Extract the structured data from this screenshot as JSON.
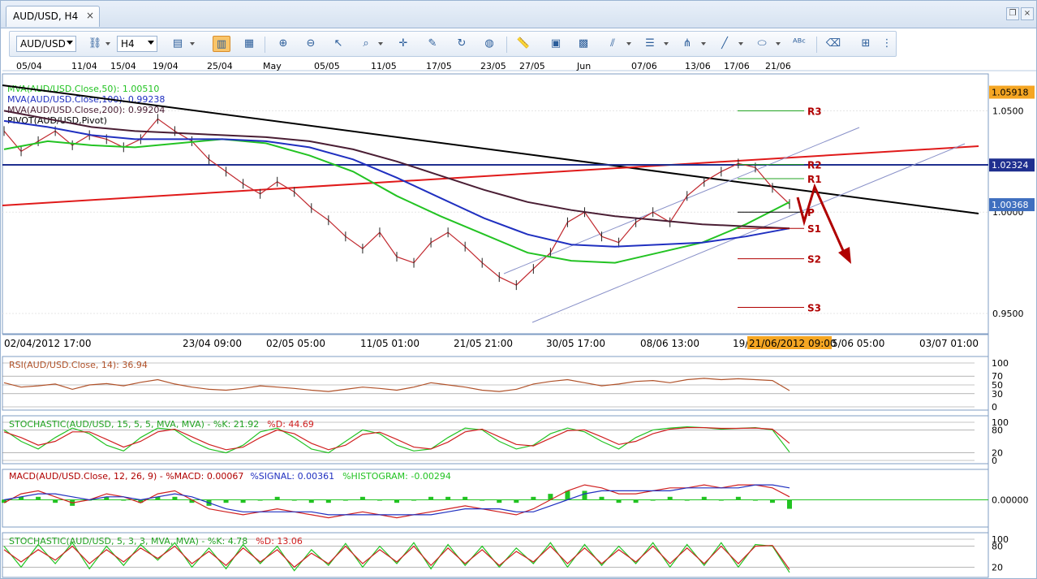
{
  "window": {
    "tab_title": "AUD/USD, H4",
    "close_glyph": "×"
  },
  "toolbar": {
    "symbol": "AUD/USD",
    "timeframe": "H4",
    "tools": [
      "chain-link-icon",
      "chart-type-icon",
      "bar-chart-icon",
      "data-window-icon",
      "zoom-in-icon",
      "zoom-out-icon",
      "cursor-icon",
      "zoom-area-icon",
      "crosshair-icon",
      "annotate-icon",
      "rotate-icon",
      "globe-icon",
      "ruler-icon",
      "picture-icon",
      "template-icon",
      "fibonacci-icon",
      "horizontal-lines-icon",
      "pitchfork-icon",
      "trendline-icon",
      "ellipse-icon",
      "text-icon",
      "eraser-icon",
      "object-tree-icon",
      "more-icon"
    ]
  },
  "chart_data": [
    {
      "type": "line",
      "panel": "price",
      "top_dates": [
        "05/04",
        "11/04",
        "15/04",
        "19/04",
        "25/04",
        "May",
        "05/05",
        "11/05",
        "17/05",
        "23/05",
        "27/05",
        "Jun",
        "07/06",
        "13/06",
        "17/06",
        "21/06"
      ],
      "bottom_dates": [
        "02/04/2012 17:00",
        "23/04 09:00",
        "02/05 05:00",
        "11/05 01:00",
        "21/05 21:00",
        "30/05 17:00",
        "08/06 13:00",
        "19/",
        "21/06/2012 09:00",
        "5/06 05:00",
        "03/07 01:00"
      ],
      "ylim": [
        0.94,
        1.065
      ],
      "yticks": [
        "1.0500",
        "1.0000",
        "0.9500"
      ],
      "price_tags": [
        {
          "label": "1.05918",
          "value": 1.05918,
          "color": "#f5a623"
        },
        {
          "label": "1.02324",
          "value": 1.02324,
          "color": "#1f2f8f"
        },
        {
          "label": "1.00368",
          "value": 1.00368,
          "color": "#3f6fbf"
        }
      ],
      "legend": [
        {
          "text": "MVA(AUD/USD.Close,50): 1.00510",
          "color": "#23c323"
        },
        {
          "text": "MVA(AUD/USD.Close,100): 0.99238",
          "color": "#2030c0"
        },
        {
          "text": "MVA(AUD/USD.Close,200): 0.99204",
          "color": "#4a1e34"
        },
        {
          "text": "PIVOT(AUD/USD,Pivot)",
          "color": "#000000"
        }
      ],
      "pivot_levels": [
        {
          "label": "R3",
          "value": 1.05
        },
        {
          "label": "R2",
          "value": 1.0235
        },
        {
          "label": "R1",
          "value": 1.0165
        },
        {
          "label": "P",
          "value": 1.0
        },
        {
          "label": "S1",
          "value": 0.992
        },
        {
          "label": "S2",
          "value": 0.977
        },
        {
          "label": "S3",
          "value": 0.953
        }
      ],
      "series": [
        {
          "name": "MVA(AUD/USD.Close,50)",
          "color": "#23c323",
          "values": [
            1.031,
            1.035,
            1.033,
            1.032,
            1.034,
            1.036,
            1.034,
            1.028,
            1.02,
            1.008,
            0.998,
            0.989,
            0.98,
            0.976,
            0.975,
            0.98,
            0.985,
            0.994,
            1.005
          ]
        },
        {
          "name": "MVA(AUD/USD.Close,100)",
          "color": "#2030c0",
          "values": [
            1.045,
            1.042,
            1.038,
            1.036,
            1.036,
            1.036,
            1.035,
            1.032,
            1.026,
            1.017,
            1.007,
            0.997,
            0.989,
            0.984,
            0.983,
            0.984,
            0.985,
            0.988,
            0.992
          ]
        },
        {
          "name": "MVA(AUD/USD.Close,200)",
          "color": "#4a1e34",
          "values": [
            1.05,
            1.046,
            1.042,
            1.04,
            1.039,
            1.038,
            1.037,
            1.035,
            1.031,
            1.025,
            1.018,
            1.011,
            1.005,
            1.001,
            0.998,
            0.996,
            0.994,
            0.993,
            0.992
          ]
        }
      ],
      "close": [
        1.04,
        1.03,
        1.035,
        1.04,
        1.033,
        1.038,
        1.036,
        1.032,
        1.036,
        1.046,
        1.04,
        1.035,
        1.026,
        1.02,
        1.014,
        1.009,
        1.015,
        1.01,
        1.002,
        0.996,
        0.988,
        0.982,
        0.99,
        0.978,
        0.975,
        0.985,
        0.99,
        0.983,
        0.975,
        0.968,
        0.964,
        0.972,
        0.98,
        0.995,
        1.0,
        0.988,
        0.985,
        0.995,
        1.0,
        0.995,
        1.008,
        1.015,
        1.02,
        1.024,
        1.022,
        1.012,
        1.004
      ]
    },
    {
      "type": "line",
      "panel": "rsi",
      "label": "RSI(AUD/USD.Close, 14): 36.94",
      "ylim": [
        0,
        100
      ],
      "yticks": [
        "100",
        "70",
        "50",
        "30",
        "0"
      ],
      "values": [
        55,
        45,
        48,
        52,
        40,
        50,
        53,
        48,
        56,
        62,
        52,
        45,
        40,
        38,
        42,
        48,
        45,
        42,
        38,
        35,
        40,
        45,
        42,
        38,
        45,
        55,
        50,
        45,
        38,
        35,
        40,
        52,
        58,
        62,
        55,
        48,
        52,
        58,
        60,
        55,
        62,
        65,
        62,
        64,
        62,
        60,
        37
      ]
    },
    {
      "type": "line",
      "panel": "stochastic",
      "label": "STOCHASTIC(AUD/USD, 15, 5, 5, MVA, MVA) - %K: 21.92",
      "d_label": "%D: 44.69",
      "ylim": [
        0,
        100
      ],
      "yticks": [
        "100",
        "80",
        "20",
        "0"
      ],
      "k_values": [
        80,
        50,
        30,
        60,
        85,
        70,
        40,
        25,
        60,
        85,
        80,
        50,
        30,
        20,
        40,
        75,
        85,
        60,
        30,
        20,
        50,
        80,
        70,
        40,
        25,
        30,
        60,
        85,
        80,
        50,
        30,
        40,
        70,
        85,
        75,
        50,
        30,
        60,
        80,
        85,
        88,
        86,
        82,
        84,
        86,
        80,
        22
      ],
      "d_values": [
        75,
        60,
        40,
        50,
        75,
        75,
        55,
        35,
        50,
        75,
        82,
        62,
        42,
        28,
        35,
        60,
        80,
        70,
        45,
        28,
        40,
        68,
        74,
        55,
        35,
        30,
        48,
        75,
        82,
        62,
        42,
        38,
        58,
        78,
        80,
        62,
        42,
        50,
        70,
        82,
        86,
        86,
        84,
        84,
        85,
        82,
        45
      ]
    },
    {
      "type": "line",
      "panel": "macd",
      "label": "MACD(AUD/USD.Close, 12, 26, 9) - %MACD: 0.00067",
      "signal_label": "%SIGNAL: 0.00361",
      "histogram_label": "%HISTOGRAM: -0.00294",
      "ylim": [
        -0.008,
        0.008
      ],
      "yticks": [
        "0.00000"
      ],
      "macd": [
        -0.001,
        0.002,
        0.003,
        0.001,
        -0.001,
        0.0,
        0.002,
        0.001,
        -0.001,
        0.002,
        0.003,
        0.0,
        -0.003,
        -0.004,
        -0.005,
        -0.004,
        -0.003,
        -0.004,
        -0.005,
        -0.006,
        -0.005,
        -0.004,
        -0.005,
        -0.006,
        -0.005,
        -0.004,
        -0.003,
        -0.002,
        -0.003,
        -0.004,
        -0.005,
        -0.003,
        0.0,
        0.003,
        0.005,
        0.004,
        0.002,
        0.002,
        0.003,
        0.004,
        0.004,
        0.005,
        0.004,
        0.005,
        0.005,
        0.004,
        0.001
      ],
      "signal": [
        0.0,
        0.001,
        0.002,
        0.002,
        0.001,
        0.0,
        0.001,
        0.001,
        0.0,
        0.001,
        0.002,
        0.001,
        -0.001,
        -0.003,
        -0.004,
        -0.004,
        -0.004,
        -0.004,
        -0.004,
        -0.005,
        -0.005,
        -0.005,
        -0.005,
        -0.005,
        -0.005,
        -0.005,
        -0.004,
        -0.003,
        -0.003,
        -0.003,
        -0.004,
        -0.004,
        -0.002,
        0.0,
        0.002,
        0.003,
        0.003,
        0.003,
        0.003,
        0.003,
        0.004,
        0.004,
        0.004,
        0.004,
        0.005,
        0.005,
        0.004
      ],
      "histogram": [
        -0.001,
        0.001,
        0.001,
        -0.001,
        -0.002,
        0.0,
        0.001,
        0.0,
        -0.001,
        0.001,
        0.001,
        -0.001,
        -0.002,
        -0.001,
        -0.001,
        0.0,
        0.001,
        0.0,
        -0.001,
        -0.001,
        0.0,
        0.001,
        0.0,
        -0.001,
        0.0,
        0.001,
        0.001,
        0.001,
        0.0,
        -0.001,
        -0.001,
        0.001,
        0.002,
        0.003,
        0.003,
        0.001,
        -0.001,
        -0.001,
        0.0,
        0.001,
        0.0,
        0.001,
        0.0,
        0.001,
        0.0,
        -0.001,
        -0.003
      ]
    },
    {
      "type": "line",
      "panel": "stochastic-fast",
      "label": "STOCHASTIC(AUD/USD, 5, 3, 3, MVA, MVA) - %K: 4.78",
      "d_label": "%D: 13.06",
      "ylim": [
        0,
        100
      ],
      "yticks": [
        "100",
        "80",
        "20"
      ],
      "k_values": [
        80,
        20,
        85,
        30,
        90,
        15,
        80,
        25,
        85,
        40,
        90,
        20,
        75,
        15,
        85,
        30,
        80,
        10,
        70,
        25,
        88,
        20,
        80,
        30,
        90,
        15,
        85,
        25,
        80,
        20,
        75,
        30,
        90,
        20,
        85,
        25,
        80,
        30,
        90,
        20,
        85,
        25,
        90,
        20,
        85,
        80,
        5
      ],
      "d_values": [
        70,
        35,
        70,
        40,
        80,
        30,
        70,
        35,
        75,
        45,
        80,
        30,
        65,
        25,
        75,
        35,
        70,
        20,
        60,
        30,
        80,
        30,
        70,
        35,
        80,
        25,
        75,
        30,
        70,
        25,
        65,
        35,
        80,
        30,
        75,
        30,
        70,
        35,
        80,
        30,
        75,
        30,
        80,
        30,
        80,
        82,
        13
      ]
    }
  ]
}
